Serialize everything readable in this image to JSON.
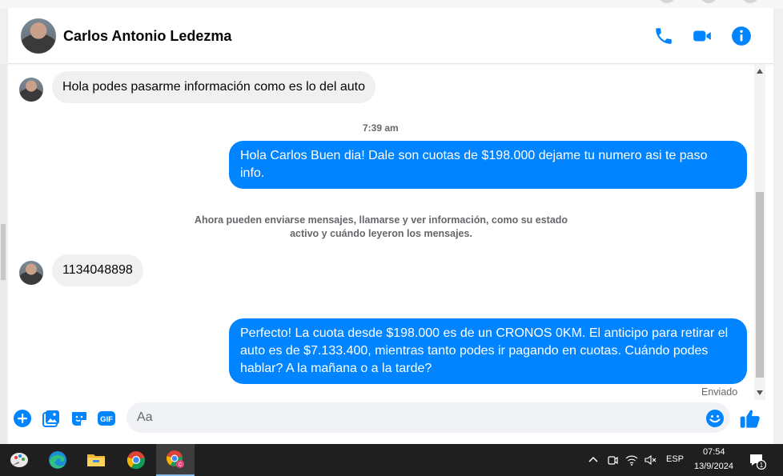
{
  "header": {
    "contact_name": "Carlos Antonio Ledezma",
    "icons": [
      "phone-icon",
      "video-camera-icon",
      "info-icon"
    ]
  },
  "messages": [
    {
      "direction": "incoming",
      "text": "Hola podes pasarme información como es lo del auto"
    },
    {
      "type": "timestamp",
      "text": "7:39 am"
    },
    {
      "direction": "outgoing",
      "lines": [
        "Hola Carlos Buen dia! Dale son cuotas de $198.000 dejame tu numero asi te paso",
        "info."
      ]
    },
    {
      "type": "system",
      "lines": [
        "Ahora pueden enviarse mensajes, llamarse y ver información, como su estado",
        "activo y cuándo leyeron los mensajes."
      ]
    },
    {
      "direction": "incoming",
      "text": "1134048898"
    },
    {
      "direction": "outgoing",
      "lines": [
        "Perfecto! La cuota desde $198.000 es de un CRONOS 0KM. El anticipo para retirar el",
        "auto es de $7.133.400, mientras tanto podes ir pagando en cuotas. Cuándo podes",
        "hablar? A la mañana o a la tarde?"
      ]
    }
  ],
  "status": {
    "sent_label": "Enviado"
  },
  "composer": {
    "placeholder": "Aa",
    "icons": [
      "plus-icon",
      "image-icon",
      "sticker-icon",
      "gif-icon",
      "emoji-icon",
      "like-icon"
    ],
    "gif_label": "GIF"
  },
  "colors": {
    "accent": "#0084ff",
    "incoming_bubble": "#f0f0f0",
    "taskbar": "#1f1f1f"
  },
  "taskbar": {
    "apps": [
      "paint-app-icon",
      "edge-icon",
      "file-explorer-icon",
      "chrome-icon",
      "chrome-profile-icon"
    ],
    "tray": {
      "language": "ESP",
      "time": "07:54",
      "date": "13/9/2024",
      "notification_count": "1"
    }
  }
}
